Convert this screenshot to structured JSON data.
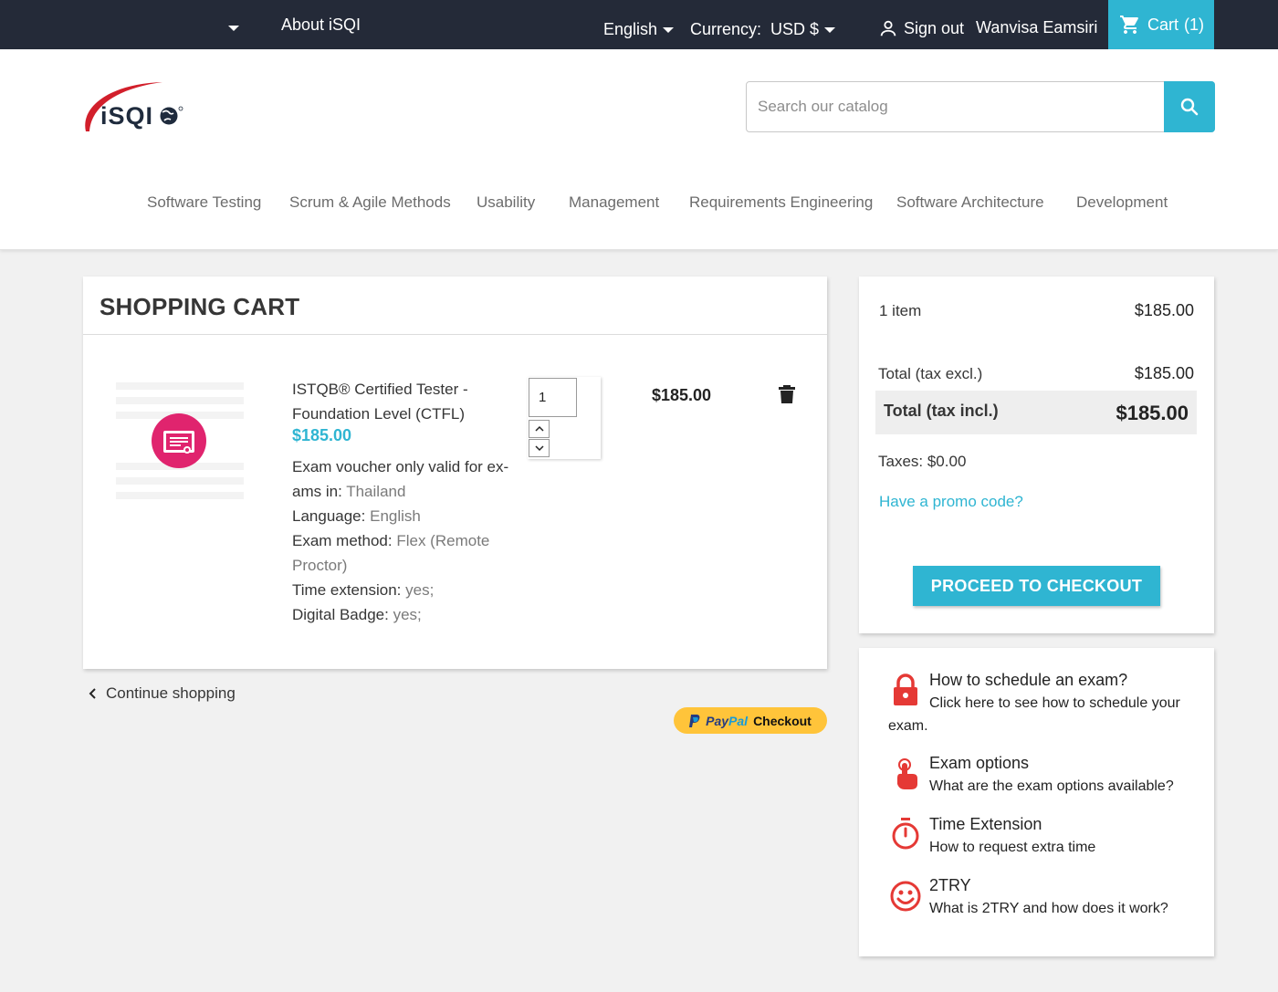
{
  "topbar": {
    "about_label": "About iSQI",
    "language": "English",
    "currency_label": "Currency:",
    "currency_value": "USD $",
    "signout_label": "Sign out",
    "user_name": "Wanvisa Eamsiri",
    "cart_label": "Cart",
    "cart_count": "(1)"
  },
  "header": {
    "logo_text": "iSQI",
    "search_placeholder": "Search our catalog"
  },
  "nav": [
    "Software Testing",
    "Scrum & Agile Methods",
    "Usability",
    "Management",
    "Requirements Engineering",
    "Software Architecture",
    "Development"
  ],
  "cart": {
    "title": "SHOPPING CART",
    "product": {
      "name_line1": "ISTQB® Certified Tester -",
      "name_line2": "Foundation Level (CTFL)",
      "price": "$185.00",
      "voucher_line1": "Exam voucher only valid for ex-",
      "voucher_line2": "ams in:",
      "voucher_value": "Thailand",
      "language_label": "Language:",
      "language_value": "English",
      "method_label": "Exam method:",
      "method_value_line1": "Flex (Remote",
      "method_value_line2": "Proctor)",
      "time_ext_label": "Time extension:",
      "time_ext_value": "yes;",
      "badge_label": "Digital Badge:",
      "badge_value": "yes;",
      "quantity": "1",
      "line_total": "$185.00"
    },
    "continue_label": "Continue shopping",
    "paypal_brand_a": "Pay",
    "paypal_brand_b": "Pal",
    "paypal_label": "Checkout"
  },
  "summary": {
    "items_label": "1 item",
    "items_value": "$185.00",
    "total_excl_label": "Total (tax excl.)",
    "total_excl_value": "$185.00",
    "total_incl_label": "Total (tax incl.)",
    "total_incl_value": "$185.00",
    "taxes_label": "Taxes: $0.00",
    "promo_label": "Have a promo code?",
    "checkout_label": "PROCEED TO CHECKOUT"
  },
  "info": [
    {
      "icon": "lock-icon",
      "title": "How to schedule an exam?",
      "desc_line1": "Click here to see how to schedule your",
      "desc_line2": "exam."
    },
    {
      "icon": "pointer-hand-icon",
      "title": "Exam options",
      "desc_line1": "What are the exam options available?"
    },
    {
      "icon": "stopwatch-icon",
      "title": "Time Extension",
      "desc_line1": "How to request extra time"
    },
    {
      "icon": "smiley-icon",
      "title": "2TRY",
      "desc_line1": "What is 2TRY and how does it work?"
    }
  ],
  "colors": {
    "topbar_bg": "#242a38",
    "accent": "#2fb5d2",
    "info_icon": "#e53935",
    "paypal_yellow": "#ffc43a"
  }
}
